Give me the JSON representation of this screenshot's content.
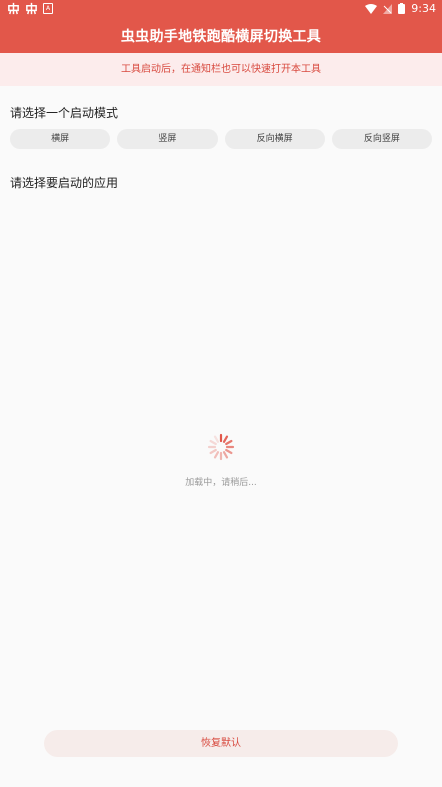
{
  "status_bar": {
    "time": "9:34",
    "colors": {
      "foreground": "#ffffff"
    }
  },
  "header": {
    "title": "虫虫助手地铁跑酷横屏切换工具",
    "background": "#e2574a"
  },
  "notice": {
    "text": "工具启动后，在通知栏也可以快速打开本工具"
  },
  "mode_section": {
    "label": "请选择一个启动模式",
    "modes": [
      {
        "label": "横屏"
      },
      {
        "label": "竖屏"
      },
      {
        "label": "反向横屏"
      },
      {
        "label": "反向竖屏"
      }
    ]
  },
  "app_section": {
    "label": "请选择要启动的应用"
  },
  "loading": {
    "text": "加载中，请稍后..."
  },
  "footer": {
    "reset_label": "恢复默认"
  }
}
